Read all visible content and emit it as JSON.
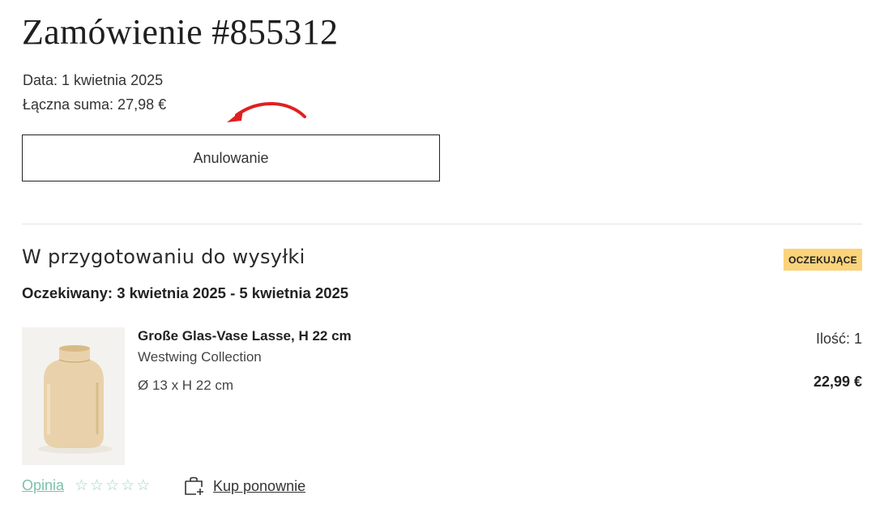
{
  "order": {
    "title": "Zamówienie #855312",
    "date_text": "Data: 1 kwietnia 2025",
    "total_text": "Łączna suma: 27,98 €",
    "cancel_label": "Anulowanie"
  },
  "shipment": {
    "title": "W przygotowaniu do wysyłki",
    "status_badge": "OCZEKUJĄCE",
    "expected_text": "Oczekiwany: 3 kwietnia 2025 - 5 kwietnia 2025",
    "item": {
      "name": "Große Glas-Vase Lasse, H 22 cm",
      "brand": "Westwing Collection",
      "dimensions": "Ø 13 x H 22 cm",
      "quantity_text": "Ilość: 1",
      "price": "22,99 €",
      "image_icon": "glass-vase-image"
    }
  },
  "actions": {
    "review_label": "Opinia",
    "rating_stars": 5,
    "rating_value": 0,
    "rebuy_label": "Kup ponownie",
    "rebuy_icon": "add-to-bag-icon"
  },
  "annotation": {
    "arrow_icon": "red-curved-arrow-icon",
    "arrow_color": "#e02020"
  },
  "colors": {
    "badge": "#fbd37a",
    "review_link": "#7dc1a8",
    "divider": "#e3e3e3"
  }
}
